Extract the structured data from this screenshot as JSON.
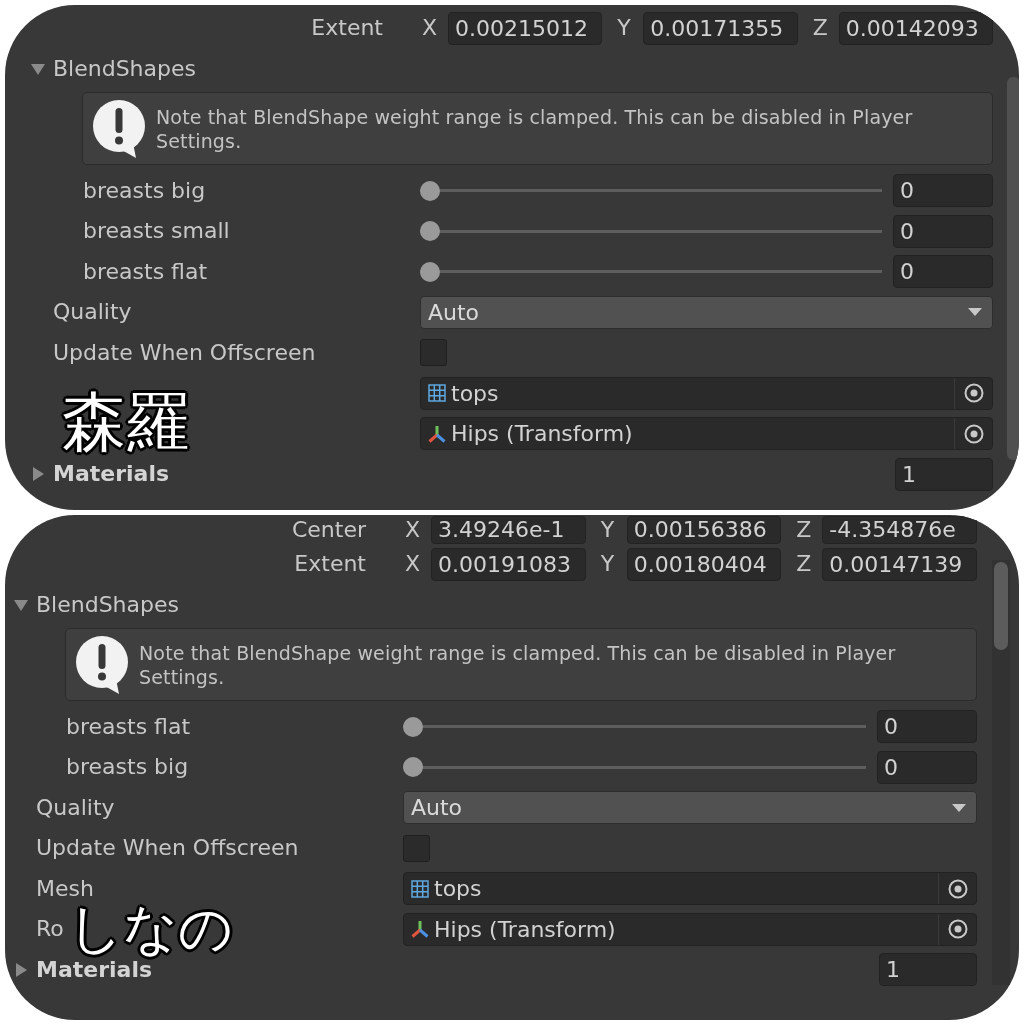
{
  "panels": [
    {
      "rows": [
        {
          "kind": "vector",
          "label": "Extent",
          "components": [
            {
              "axis": "X",
              "value": "0.00215012"
            },
            {
              "axis": "Y",
              "value": "0.00171355"
            },
            {
              "axis": "Z",
              "value": "0.00142093"
            }
          ]
        },
        {
          "kind": "foldout",
          "label": "BlendShapes",
          "expanded": true,
          "overridden": false,
          "children": [
            {
              "kind": "note",
              "text": "Note that BlendShape weight range is clamped. This can be disabled in Player Settings."
            },
            {
              "kind": "slider",
              "label": "breasts big",
              "level": 0,
              "value": "0"
            },
            {
              "kind": "slider",
              "label": "breasts small",
              "level": 0,
              "value": "0"
            },
            {
              "kind": "slider",
              "label": "breasts flat",
              "level": 0,
              "value": "0"
            }
          ]
        },
        {
          "kind": "dropdown",
          "label": "Quality",
          "value": "Auto"
        },
        {
          "kind": "checkbox",
          "label": "Update When Offscreen",
          "checked": false
        },
        {
          "kind": "mesh",
          "value": "tops"
        },
        {
          "kind": "bone",
          "value": "Hips (Transform)"
        },
        {
          "kind": "foldout",
          "label": "Materials",
          "expanded": false,
          "overridden": true,
          "size": "1"
        }
      ],
      "caption": "森羅"
    },
    {
      "rows": [
        {
          "kind": "vector",
          "label": "Center",
          "components": [
            {
              "axis": "X",
              "value": "3.49246e-1"
            },
            {
              "axis": "Y",
              "value": "0.00156386"
            },
            {
              "axis": "Z",
              "value": "-4.354876e"
            }
          ]
        },
        {
          "kind": "vector",
          "label": "Extent",
          "components": [
            {
              "axis": "X",
              "value": "0.00191083"
            },
            {
              "axis": "Y",
              "value": "0.00180404"
            },
            {
              "axis": "Z",
              "value": "0.00147139"
            }
          ]
        },
        {
          "kind": "foldout",
          "label": "BlendShapes",
          "expanded": true,
          "overridden": false,
          "children": [
            {
              "kind": "note",
              "text": "Note that BlendShape weight range is clamped. This can be disabled in Player Settings."
            },
            {
              "kind": "slider",
              "label": "breasts flat",
              "level": 0,
              "value": "0"
            },
            {
              "kind": "slider",
              "label": "breasts big",
              "level": 0,
              "value": "0"
            }
          ]
        },
        {
          "kind": "dropdown",
          "label": "Quality",
          "value": "Auto"
        },
        {
          "kind": "checkbox",
          "label": "Update When Offscreen",
          "checked": false
        },
        {
          "kind": "mesh",
          "label": "Mesh",
          "value": "tops"
        },
        {
          "kind": "bone",
          "label": "Ro",
          "value": "Hips (Transform)"
        },
        {
          "kind": "foldout",
          "label": "Materials",
          "expanded": false,
          "overridden": true,
          "size": "1"
        }
      ],
      "caption": "しなの"
    }
  ]
}
